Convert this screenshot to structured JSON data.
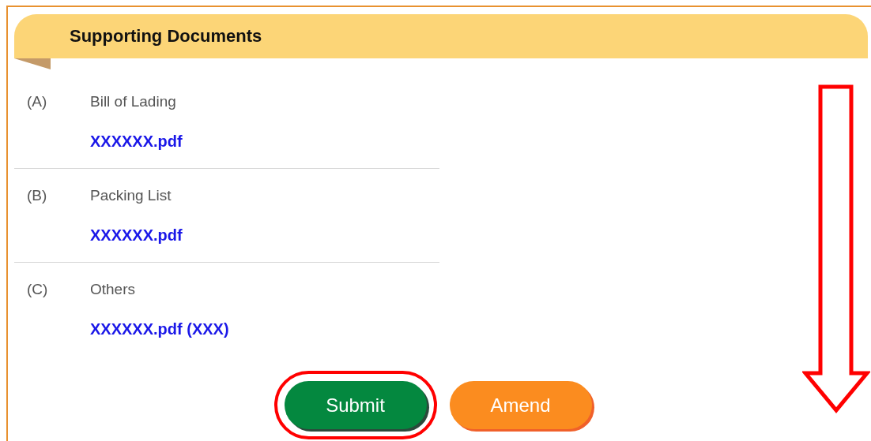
{
  "section": {
    "title": "Supporting Documents"
  },
  "documents": [
    {
      "index": "(A)",
      "name": "Bill of Lading",
      "file": "XXXXXX.pdf"
    },
    {
      "index": "(B)",
      "name": "Packing List",
      "file": "XXXXXX.pdf"
    },
    {
      "index": "(C)",
      "name": "Others",
      "file": "XXXXXX.pdf (XXX)"
    }
  ],
  "buttons": [
    {
      "label": "Submit",
      "color": "#04883f",
      "highlighted": true
    },
    {
      "label": "Amend",
      "color": "#fb8c1f",
      "highlighted": false
    }
  ]
}
